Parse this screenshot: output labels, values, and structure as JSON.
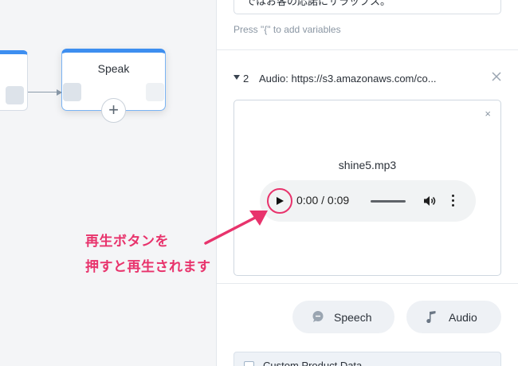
{
  "canvas": {
    "speak_node_title": "Speak",
    "add_button": "+"
  },
  "panel": {
    "top_input_text": "ではお客の応諾にサラップス。",
    "variables_hint": "Press \"{\" to add variables",
    "item": {
      "number": "2",
      "title": "Audio: https://s3.amazonaws.com/co..."
    },
    "audio_card": {
      "close": "×",
      "file_name": "shine5.mp3",
      "time": "0:00 / 0:09"
    },
    "buttons": {
      "speech": "Speech",
      "audio": "Audio"
    },
    "bottom_box_label": "Custom Product Data"
  },
  "annotation": {
    "line1": "再生ボタンを",
    "line2": "押すと再生されます",
    "color": "#e8336c"
  },
  "colors": {
    "accent_blue": "#3d8ef0",
    "annotation_pink": "#e8336c"
  }
}
